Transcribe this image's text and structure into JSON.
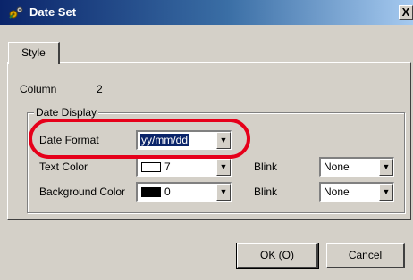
{
  "window": {
    "title": "Date Set",
    "close_glyph": "X",
    "icon": "app-gear-icon"
  },
  "tabs": [
    {
      "label": "Style",
      "active": true
    }
  ],
  "column": {
    "label": "Column",
    "value": "2"
  },
  "date_display": {
    "group_label": "Date Display",
    "date_format": {
      "label": "Date Format",
      "value": "yy/mm/dd"
    },
    "text_color": {
      "label": "Text Color",
      "value": "7",
      "swatch": "#ffffff"
    },
    "background_color": {
      "label": "Background Color",
      "value": "0",
      "swatch": "#000000"
    },
    "text_blink": {
      "label": "Blink",
      "value": "None"
    },
    "background_blink": {
      "label": "Blink",
      "value": "None"
    }
  },
  "buttons": {
    "ok": "OK (O)",
    "cancel": "Cancel"
  },
  "colors": {
    "dialog_face": "#d4d0c8",
    "title_gradient_start": "#0a246a",
    "highlight_ring": "#e6001a"
  }
}
